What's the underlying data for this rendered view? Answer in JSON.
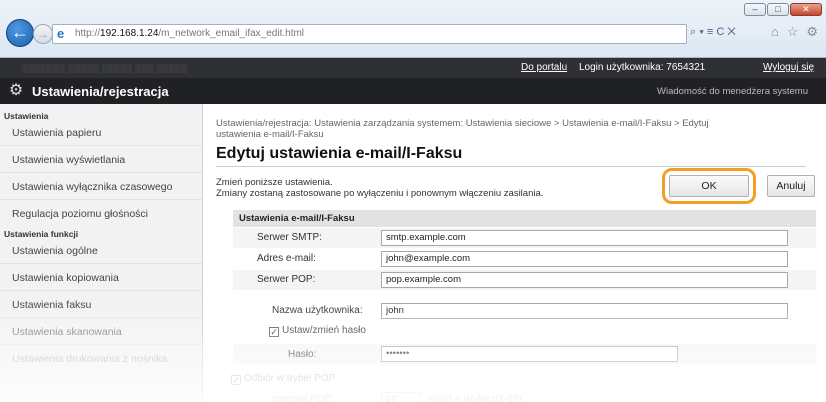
{
  "browser": {
    "url_prefix": "http://",
    "url_host": "192.168.1.24",
    "url_path": "/m_network_email_ifax_edit.html",
    "addr_tools": "⌕ ▾ ≡ C ✕",
    "win_min": "–",
    "win_max": "□",
    "win_close": "✕"
  },
  "topbar": {
    "blurred_text": "░░░░░░░  ░░░░░ ░░░░░  ░░░ ░░░░░",
    "portal_link": "Do portalu",
    "login_text": "Login użytkownika: 7654321",
    "logout_link": "Wyloguj się"
  },
  "titlebar": {
    "title": "Ustawienia/rejestracja",
    "admin_msg": "Wiadomość do menedżera systemu"
  },
  "sidebar": {
    "group1": "Ustawienia",
    "items1": [
      "Ustawienia papieru",
      "Ustawienia wyświetlania",
      "Ustawienia wyłącznika czasowego",
      "Regulacja poziomu głośności"
    ],
    "group2": "Ustawienia funkcji",
    "items2": [
      "Ustawienia ogólne",
      "Ustawienia kopiowania",
      "Ustawienia faksu",
      "Ustawienia skanowania",
      "Ustawienia drukowania z nośnika"
    ]
  },
  "main": {
    "breadcrumb_line1": "Ustawienia/rejestracja: Ustawienia zarządzania systemem: Ustawienia sieciowe > Ustawienia e-mail/I-Faksu > Edytuj",
    "breadcrumb_line2": "ustawienia e-mail/I-Faksu",
    "heading": "Edytuj ustawienia e-mail/I-Faksu",
    "desc1": "Zmień poniższe ustawienia.",
    "desc2": "Zmiany zostaną zastosowane po wyłączeniu i ponownym włączeniu zasilania.",
    "ok_label": "OK",
    "cancel_label": "Anuluj",
    "section_title": "Ustawienia e-mail/I-Faksu",
    "smtp_label": "Serwer SMTP:",
    "smtp_value": "smtp.example.com",
    "email_label": "Adres e-mail:",
    "email_value": "john@example.com",
    "pop_label": "Serwer POP:",
    "pop_value": "pop.example.com",
    "username_label": "Nazwa użytkownika:",
    "username_value": "john",
    "set_password_label": "Ustaw/zmień hasło",
    "set_password_checked": true,
    "password_label": "Hasło:",
    "password_value": "•••••••",
    "pop_receive_label": "Odbiór w trybie POP",
    "pop_receive_checked": true,
    "pop_interval_label": "Interwał POP:",
    "pop_interval_value": "10",
    "pop_interval_hint": "min(0 = Wyłącz/1-99)"
  }
}
